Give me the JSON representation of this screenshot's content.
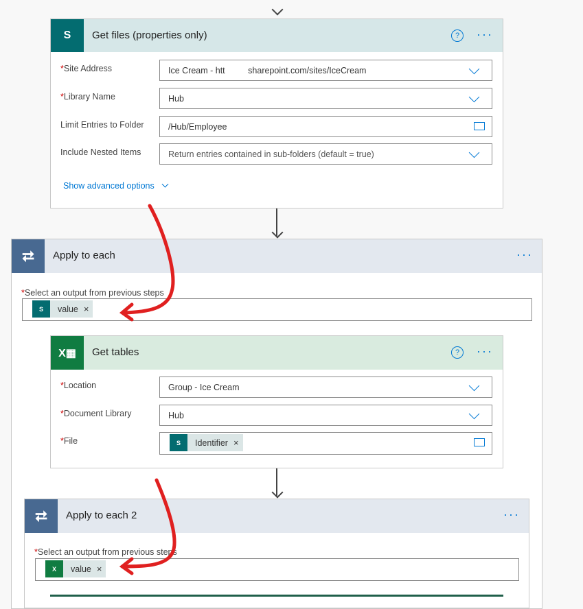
{
  "get_files": {
    "title": "Get files (properties only)",
    "icon": "sharepoint-icon",
    "icon_letter": "S",
    "fields": [
      {
        "label": "Site Address",
        "required": true,
        "value": "Ice Cream - htt             sharepoint.com/sites/IceCream",
        "control": "dropdown"
      },
      {
        "label": "Library Name",
        "required": true,
        "value": "Hub",
        "control": "dropdown"
      },
      {
        "label": "Limit Entries to Folder",
        "required": false,
        "value": "/Hub/Employee",
        "control": "folder"
      },
      {
        "label": "Include Nested Items",
        "required": false,
        "value": "Return entries contained in sub-folders (default = true)",
        "control": "dropdown"
      }
    ],
    "advanced": "Show advanced options"
  },
  "apply1": {
    "title": "Apply to each",
    "label": "Select an output from previous steps",
    "token": "value"
  },
  "get_tables": {
    "title": "Get tables",
    "icon": "excel-icon",
    "fields": [
      {
        "label": "Location",
        "value": "Group - Ice Cream"
      },
      {
        "label": "Document Library",
        "value": "Hub"
      },
      {
        "label": "File",
        "token": "Identifier"
      }
    ]
  },
  "apply2": {
    "title": "Apply to each 2",
    "label": "Select an output from previous steps",
    "token": "value"
  },
  "colors": {
    "sharepoint": "#036c70",
    "excel": "#107c41",
    "loop": "#486991",
    "accent": "#0078d4",
    "annotation": "#e02020"
  }
}
